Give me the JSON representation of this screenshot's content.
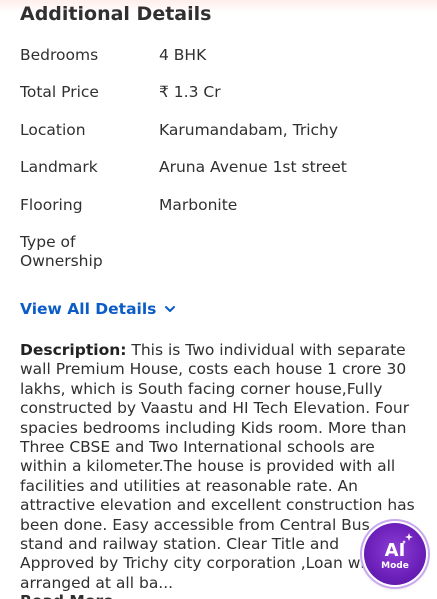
{
  "section": {
    "title": "Additional Details"
  },
  "details": [
    {
      "label": "Bedrooms",
      "value": "4 BHK"
    },
    {
      "label": "Total Price",
      "value": "₹ 1.3 Cr"
    },
    {
      "label": "Location",
      "value": "Karumandabam, Trichy"
    },
    {
      "label": "Landmark",
      "value": "Aruna Avenue 1st street"
    },
    {
      "label": "Flooring",
      "value": "Marbonite"
    },
    {
      "label": "Type of Ownership",
      "value": ""
    }
  ],
  "view_all": {
    "label": "View All Details",
    "icon": "chevron-down-icon"
  },
  "description": {
    "label": "Description:",
    "text": "This is Two individual with separate wall Premium House, costs each house 1 crore 30 lakhs, which is South facing corner house,Fully constructed by Vaastu and HI Tech Elevation. Four spacies bedrooms including Kids room. More than Three CBSE and  Two International schools are  within a kilometer.The house is provided with all facilities and utilities at reasonable rate. An attractive elevation and excellent construction has been done. Easy accessible from Central Bus stand  and railway station. Clear Title and Approved by Trichy city corporation ,Loan will be arranged at all ba..."
  },
  "read_more": {
    "label": "Read More"
  },
  "ai_badge": {
    "ai_label": "AI",
    "mode_label": "Mode",
    "icon": "sparkle-icon"
  },
  "colors": {
    "link": "#0b5cc7",
    "text": "#303030",
    "ai_purple": "#6a1fb8"
  }
}
